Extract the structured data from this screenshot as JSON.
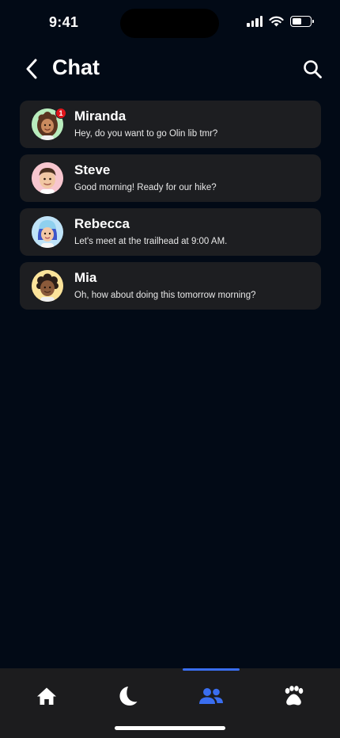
{
  "status_bar": {
    "time": "9:41"
  },
  "header": {
    "title": "Chat",
    "back_icon": "chevron-left-icon",
    "search_icon": "search-icon"
  },
  "chats": [
    {
      "name": "Miranda",
      "preview": "Hey, do you want to go Olin lib tmr?",
      "unread": "1",
      "avatar_bg": "#b9ecbd"
    },
    {
      "name": "Steve",
      "preview": "Good morning! Ready for our hike?",
      "unread": null,
      "avatar_bg": "#f7c6cf"
    },
    {
      "name": "Rebecca",
      "preview": "Let's meet at the trailhead at 9:00 AM.",
      "unread": null,
      "avatar_bg": "#bfe3f8"
    },
    {
      "name": "Mia",
      "preview": "Oh, how about doing this tomorrow morning?",
      "unread": null,
      "avatar_bg": "#fbe39a"
    }
  ],
  "bottom_nav": {
    "items": [
      {
        "name": "home",
        "icon": "home-icon",
        "active": false
      },
      {
        "name": "sleep",
        "icon": "moon-icon",
        "active": false
      },
      {
        "name": "friends",
        "icon": "people-icon",
        "active": true
      },
      {
        "name": "pets",
        "icon": "paw-icon",
        "active": false
      }
    ]
  },
  "colors": {
    "background": "#020a16",
    "card": "#1d1e21",
    "accent": "#3a6ef0",
    "badge": "#e0151b",
    "nav_bg": "#1c1c1e"
  }
}
